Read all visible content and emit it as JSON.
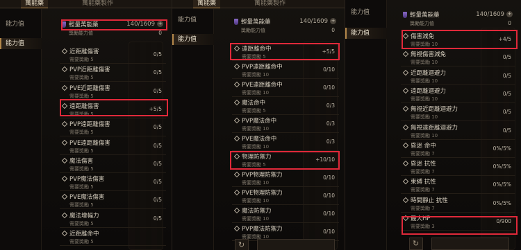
{
  "tabs": {
    "elixir": "萬能藥",
    "elixir_craft": "萬能藥製作"
  },
  "sidebar": {
    "stats": "能力值"
  },
  "potion": {
    "name": "輕量萬能藥",
    "count": "140/1609",
    "plus": "+",
    "bonus_label": "獎勵能力值",
    "bonus_value": "0"
  },
  "panel1": {
    "rows": [
      {
        "name": "近距離傷害",
        "req": "需要獎勵 5",
        "val": "0/5"
      },
      {
        "name": "PVP近距離傷害",
        "req": "需要獎勵 5",
        "val": "0/5"
      },
      {
        "name": "PVE近距離傷害",
        "req": "需要獎勵 5",
        "val": "0/5"
      },
      {
        "name": "遠距離傷害",
        "req": "需要獎勵 5",
        "val": "+5/5"
      },
      {
        "name": "PVP遠距離傷害",
        "req": "需要獎勵 5",
        "val": "0/5"
      },
      {
        "name": "PVE遠距離傷害",
        "req": "需要獎勵 5",
        "val": "0/5"
      },
      {
        "name": "魔法傷害",
        "req": "需要獎勵 5",
        "val": "0/5"
      },
      {
        "name": "PVP魔法傷害",
        "req": "需要獎勵 5",
        "val": "0/5"
      },
      {
        "name": "PVE魔法傷害",
        "req": "需要獎勵 5",
        "val": "0/5"
      },
      {
        "name": "魔法增幅力",
        "req": "需要獎勵 5",
        "val": "0/5"
      },
      {
        "name": "近距離命中",
        "req": "需要獎勵 5",
        "val": ""
      }
    ]
  },
  "panel2": {
    "rows": [
      {
        "name": "遠距離命中",
        "req": "需要獎勵 5",
        "val": "+5/5"
      },
      {
        "name": "PVP遠距離命中",
        "req": "需要獎勵 10",
        "val": "0/10"
      },
      {
        "name": "PVE遠距離命中",
        "req": "需要獎勵 10",
        "val": "0/10"
      },
      {
        "name": "魔法命中",
        "req": "需要獎勵 5",
        "val": "0/3"
      },
      {
        "name": "PVP魔法命中",
        "req": "需要獎勵 10",
        "val": "0/3"
      },
      {
        "name": "PVE魔法命中",
        "req": "需要獎勵 10",
        "val": "0/3"
      },
      {
        "name": "物理防禦力",
        "req": "需要獎勵 5",
        "val": "+10/10"
      },
      {
        "name": "PVP物理防禦力",
        "req": "需要獎勵 10",
        "val": "0/10"
      },
      {
        "name": "PVE物理防禦力",
        "req": "需要獎勵 10",
        "val": "0/10"
      },
      {
        "name": "魔法防禦力",
        "req": "需要獎勵 10",
        "val": "0/10"
      },
      {
        "name": "PVP魔法防禦力",
        "req": "需要獎勵 10",
        "val": "0/10"
      }
    ]
  },
  "panel3": {
    "rows": [
      {
        "name": "傷害減免",
        "req": "需要獎勵 10",
        "val": "+4/5"
      },
      {
        "name": "無視傷害減免",
        "req": "需要獎勵 10",
        "val": "0/5"
      },
      {
        "name": "近距離迴避力",
        "req": "需要獎勵 10",
        "val": "0/5"
      },
      {
        "name": "遠距離迴避力",
        "req": "需要獎勵 10",
        "val": "0/5"
      },
      {
        "name": "無視近距離迴避力",
        "req": "需要獎勵 10",
        "val": "0/5"
      },
      {
        "name": "無視遠距離迴避力",
        "req": "需要獎勵 10",
        "val": "0/5"
      },
      {
        "name": "昏迷 命中",
        "req": "需要獎勵 7",
        "val": "0%/5%"
      },
      {
        "name": "昏迷 抗性",
        "req": "需要獎勵 7",
        "val": "0%/5%"
      },
      {
        "name": "束縛 抗性",
        "req": "需要獎勵 7",
        "val": "0%/5%"
      },
      {
        "name": "時間靜止 抗性",
        "req": "需要獎勵 7",
        "val": "0%/5%"
      },
      {
        "name": "最大HP",
        "req": "需要獎勵 3",
        "val": "0/900"
      }
    ]
  },
  "icons": {
    "refresh": "refresh-icon"
  },
  "colors": {
    "highlight": "#e0293a",
    "accent": "#b5884a"
  }
}
